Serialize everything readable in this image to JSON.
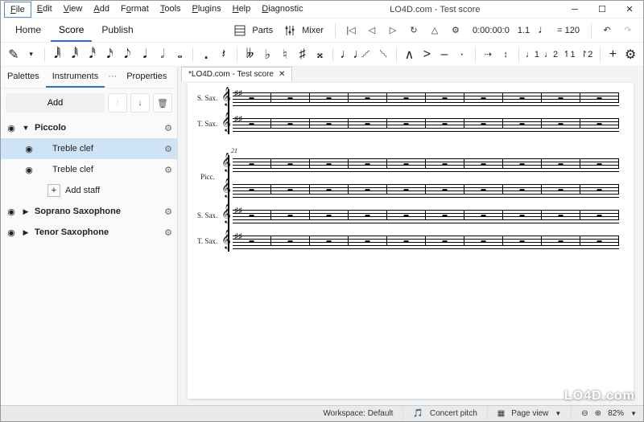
{
  "window": {
    "title": "LO4D.com - Test score"
  },
  "menubar": [
    "File",
    "Edit",
    "View",
    "Add",
    "Format",
    "Tools",
    "Plugins",
    "Help",
    "Diagnostic"
  ],
  "main_tabs": {
    "items": [
      "Home",
      "Score",
      "Publish"
    ],
    "active": "Score"
  },
  "toolbar": {
    "parts": "Parts",
    "mixer": "Mixer",
    "time": "0:00:00:0",
    "position": "1.1",
    "tempo_glyph": "♩",
    "tempo_eq": "= 120"
  },
  "note_toolbar": {
    "durations": [
      "𝅘𝅥𝅲",
      "𝅘𝅥𝅱",
      "𝅘𝅥𝅰",
      "𝅘𝅥𝅯",
      "𝅘𝅥𝅮",
      "𝅘𝅥",
      "𝅗𝅥",
      "𝅝"
    ],
    "dot": ".",
    "rest": "𝄽",
    "accidentals": [
      "𝄫",
      "♭",
      "♮",
      "♯",
      "𝄪"
    ],
    "ties": [
      "♩♩",
      "𝆱",
      "𝆲"
    ],
    "artic": [
      "∧",
      ">",
      "–",
      "·"
    ],
    "voices": [
      "♩1",
      "♩2",
      "↿1",
      "↾2"
    ],
    "plus": "+"
  },
  "sidebar": {
    "tabs": [
      "Palettes",
      "Instruments",
      "Properties"
    ],
    "active": "Instruments",
    "add_label": "Add",
    "tree": {
      "piccolo": "Piccolo",
      "treble1": "Treble clef",
      "treble2": "Treble clef",
      "addstaff": "Add staff",
      "soprano": "Soprano Saxophone",
      "tenor": "Tenor Saxophone"
    }
  },
  "doc_tab": "*LO4D.com - Test score",
  "score": {
    "labels": {
      "ssax": "S. Sax.",
      "tsax": "T. Sax.",
      "picc": "Picc."
    },
    "measure_start_2": "21"
  },
  "statusbar": {
    "workspace": "Workspace: Default",
    "concert": "Concert pitch",
    "pageview": "Page view",
    "zoom": "82%"
  },
  "watermark": "LO4D.com"
}
